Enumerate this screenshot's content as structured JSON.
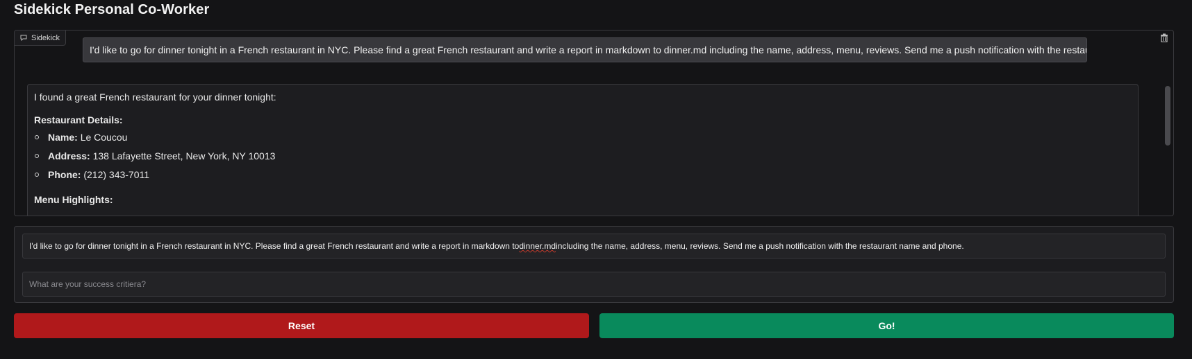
{
  "app": {
    "title": "Sidekick Personal Co-Worker"
  },
  "chatbot": {
    "label": "Sidekick",
    "icons": {
      "label": "chat-bubble-icon",
      "clear": "trash-icon"
    },
    "user_message": "I'd like to go for dinner tonight in a French restaurant in NYC. Please find a great French restaurant and write a report in markdown to dinner.md including the name, address, menu, reviews. Send me a push notification with the restaurant name and phone.",
    "bot_message": {
      "intro": "I found a great French restaurant for your dinner tonight:",
      "details_heading": "Restaurant Details:",
      "details": [
        {
          "key": "Name:",
          "value": "Le Coucou"
        },
        {
          "key": "Address:",
          "value": "138 Lafayette Street, New York, NY 10013"
        },
        {
          "key": "Phone:",
          "value": "(212) 343-7011"
        }
      ],
      "menu_heading": "Menu Highlights:"
    }
  },
  "inputs": {
    "message_value_pre": "I'd like to go for dinner tonight in a French restaurant in NYC. Please find a great French restaurant and write a report in markdown to ",
    "message_value_flag": "dinner.md",
    "message_value_post": " including the name, address, menu, reviews. Send me a push notification with the restaurant name and phone.",
    "success_placeholder": "What are your success critiera?"
  },
  "buttons": {
    "reset": "Reset",
    "go": "Go!"
  },
  "colors": {
    "reset": "#b0191b",
    "go": "#098a5c",
    "background": "#141416"
  }
}
